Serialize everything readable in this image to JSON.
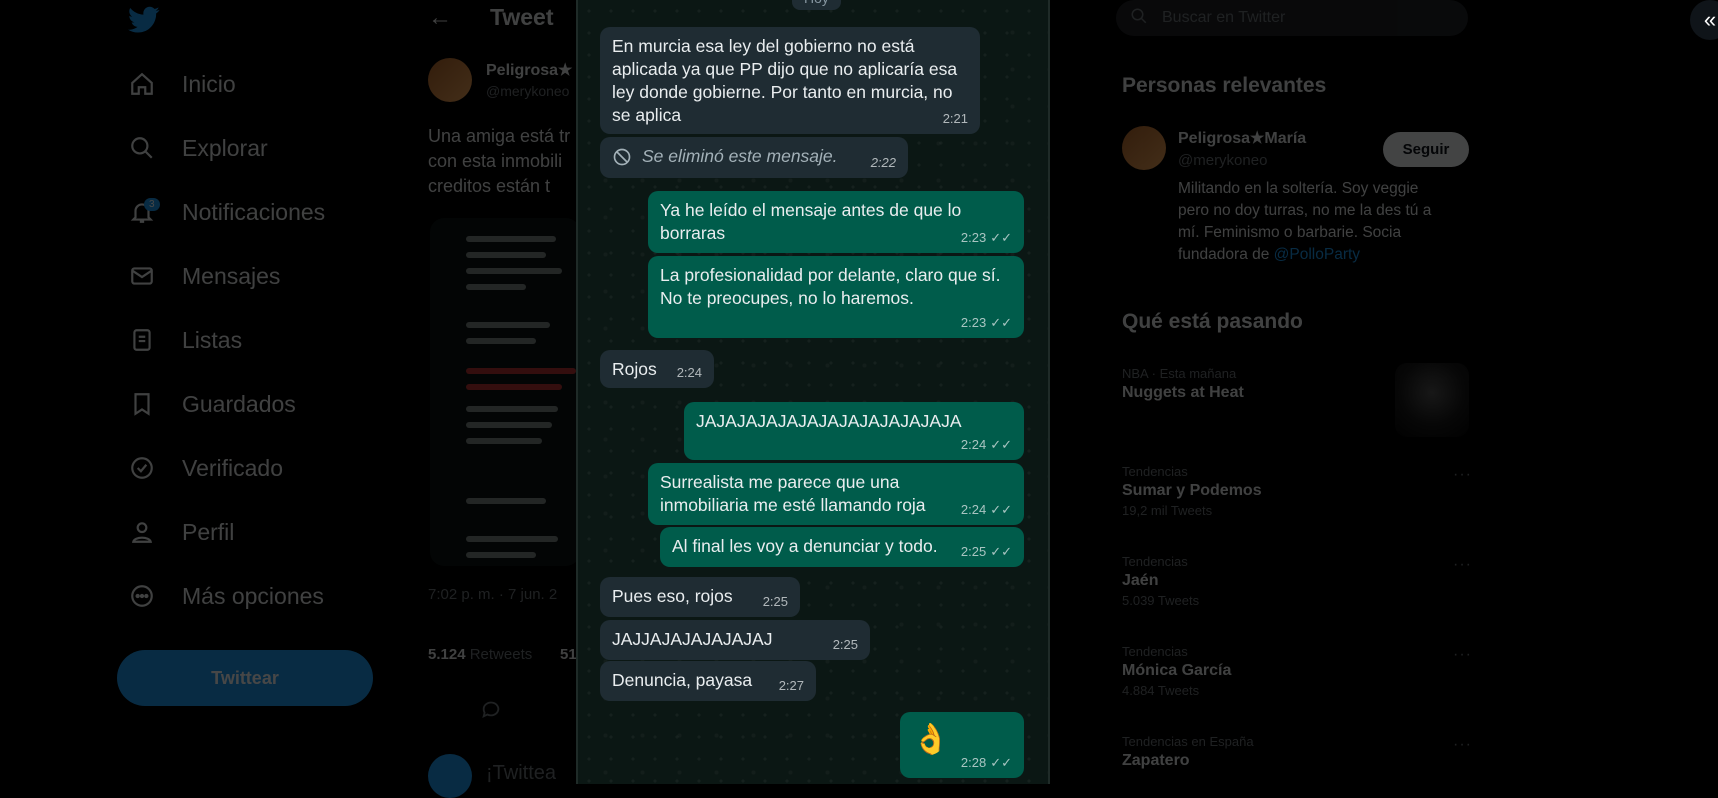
{
  "nav": {
    "items": [
      {
        "label": "Inicio",
        "icon": "home-icon"
      },
      {
        "label": "Explorar",
        "icon": "search-icon"
      },
      {
        "label": "Notificaciones",
        "icon": "bell-icon",
        "badge": "3"
      },
      {
        "label": "Mensajes",
        "icon": "mail-icon"
      },
      {
        "label": "Listas",
        "icon": "list-icon"
      },
      {
        "label": "Guardados",
        "icon": "bookmark-icon"
      },
      {
        "label": "Verificado",
        "icon": "verified-icon"
      },
      {
        "label": "Perfil",
        "icon": "person-icon"
      },
      {
        "label": "Más opciones",
        "icon": "more-circle-icon"
      }
    ],
    "tweet_button": "Twittear"
  },
  "tweet": {
    "header_title": "Tweet",
    "author_name": "Peligrosa★",
    "author_handle": "@merykoneo",
    "text": "Una amiga está tr con esta inmobili creditos están t",
    "date": "7:02 p. m. · 7 jun. 2",
    "retweets": "5.124",
    "retweets_label": "Retweets",
    "likes_fragment": "51",
    "reply_prompt": "¡Twittea"
  },
  "search": {
    "placeholder": "Buscar en Twitter"
  },
  "relevant": {
    "title": "Personas relevantes",
    "name": "Peligrosa★María",
    "handle": "@merykoneo",
    "bio": "Militando en la soltería. Soy veggie pero no doy turras, no me la des tú a mí. Feminismo o barbarie. Socia fundadora de ",
    "bio_link": "@PolloParty",
    "follow": "Seguir"
  },
  "trends": {
    "title": "Qué está pasando",
    "items": [
      {
        "meta": "NBA · Esta mañana",
        "name": "Nuggets at Heat",
        "count": ""
      },
      {
        "meta": "Tendencias",
        "name": "Sumar y Podemos",
        "count": "19,2 mil Tweets"
      },
      {
        "meta": "Tendencias",
        "name": "Jaén",
        "count": "5.039 Tweets"
      },
      {
        "meta": "Tendencias",
        "name": "Mónica García",
        "count": "4.884 Tweets"
      },
      {
        "meta": "Tendencias en España",
        "name": "Zapatero",
        "count": ""
      }
    ]
  },
  "chat": {
    "date_chip": "Hoy",
    "messages": [
      {
        "dir": "in",
        "text": "En murcia esa ley del gobierno no está aplicada ya que PP dijo que no aplicaría esa ley donde gobierne. Por tanto en murcia, no se aplica",
        "time": "2:21"
      },
      {
        "dir": "in",
        "text": "Se eliminó este mensaje.",
        "time": "2:22",
        "deleted": true
      },
      {
        "dir": "out",
        "text": "Ya he leído el mensaje antes de que lo borraras",
        "time": "2:23"
      },
      {
        "dir": "out",
        "text": "La profesionalidad por delante, claro que sí. No te preocupes, no lo haremos.",
        "time": "2:23"
      },
      {
        "dir": "in",
        "text": "Rojos",
        "time": "2:24"
      },
      {
        "dir": "out",
        "text": "JAJAJAJAJAJAJAJAJAJAJAJAJA",
        "time": "2:24"
      },
      {
        "dir": "out",
        "text": "Surrealista me parece que una inmobiliaria me esté llamando roja",
        "time": "2:24"
      },
      {
        "dir": "out",
        "text": "Al final les voy a denunciar y todo.",
        "time": "2:25"
      },
      {
        "dir": "in",
        "text": "Pues eso, rojos",
        "time": "2:25"
      },
      {
        "dir": "in",
        "text": "JAJJAJAJAJAJAJAJ",
        "time": "2:25"
      },
      {
        "dir": "in",
        "text": "Denuncia, payasa",
        "time": "2:27"
      },
      {
        "dir": "out",
        "text": "👌",
        "time": "2:28"
      }
    ]
  },
  "colors": {
    "accent": "#1d9bf0",
    "bubble_in": "#1f2c33",
    "bubble_out": "#005c4b"
  }
}
